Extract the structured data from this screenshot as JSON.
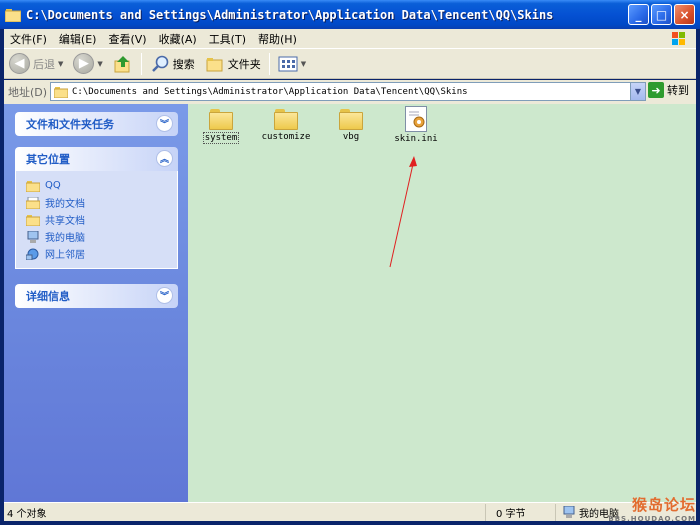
{
  "window": {
    "title": "C:\\Documents and Settings\\Administrator\\Application Data\\Tencent\\QQ\\Skins",
    "buttons": [
      "_",
      "□",
      "×"
    ]
  },
  "menu": {
    "items": [
      "文件(F)",
      "编辑(E)",
      "查看(V)",
      "收藏(A)",
      "工具(T)",
      "帮助(H)"
    ]
  },
  "toolbar": {
    "back_label": "后退",
    "search_label": "搜索",
    "folders_label": "文件夹"
  },
  "address": {
    "label": "地址(D)",
    "path": "C:\\Documents and Settings\\Administrator\\Application Data\\Tencent\\QQ\\Skins",
    "go_label": "转到"
  },
  "sidebar": {
    "tasks_title": "文件和文件夹任务",
    "places_title": "其它位置",
    "places": [
      {
        "label": "QQ",
        "icon": "folder-icon"
      },
      {
        "label": "我的文档",
        "icon": "my-documents-icon"
      },
      {
        "label": "共享文档",
        "icon": "folder-icon"
      },
      {
        "label": "我的电脑",
        "icon": "computer-icon"
      },
      {
        "label": "网上邻居",
        "icon": "network-icon"
      }
    ],
    "details_title": "详细信息"
  },
  "files": [
    {
      "name": "system",
      "type": "folder",
      "selected": true
    },
    {
      "name": "customize",
      "type": "folder"
    },
    {
      "name": "vbg",
      "type": "folder"
    },
    {
      "name": "skin.ini",
      "type": "ini-file"
    }
  ],
  "status": {
    "objects": "4 个对象",
    "size": "0 字节",
    "location": "我的电脑"
  },
  "watermark": {
    "main": "猴岛论坛",
    "sub": "BBS.HOUDAO.COM"
  },
  "colors": {
    "title_bar": "#0551d3",
    "sidebar": "#6b88de",
    "content_bg": "#cde8cd",
    "annotation_arrow": "#e02020"
  }
}
